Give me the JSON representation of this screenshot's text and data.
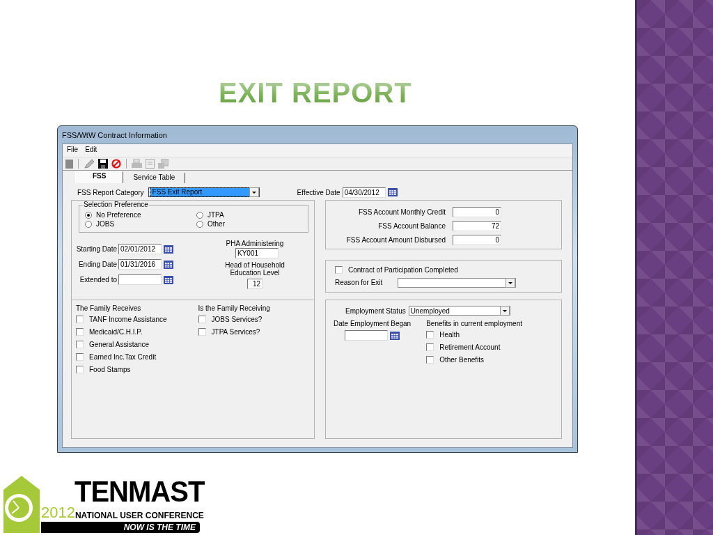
{
  "slide": {
    "title": "EXIT REPORT"
  },
  "window": {
    "title": "FSS/WtW Contract Information"
  },
  "menu": [
    "File",
    "Edit"
  ],
  "tabs": [
    {
      "label": "FSS",
      "selected": true
    },
    {
      "label": "Service Table",
      "selected": false
    }
  ],
  "report_category": {
    "label": "FSS Report Category",
    "value": "FSS Exit Report"
  },
  "effective_date": {
    "label": "Effective Date",
    "value": "04/30/2012"
  },
  "selection_preference": {
    "title": "Selection Preference",
    "options": [
      {
        "label": "No Preference",
        "selected": true
      },
      {
        "label": "JTPA",
        "selected": false
      },
      {
        "label": "JOBS",
        "selected": false
      },
      {
        "label": "Other",
        "selected": false
      }
    ]
  },
  "dates": [
    {
      "label": "Starting Date",
      "value": "02/01/2012"
    },
    {
      "label": "Ending Date",
      "value": "01/31/2016"
    },
    {
      "label": "Extended to"
    }
  ],
  "pha": {
    "label": "PHA Administering",
    "value": "KY001"
  },
  "education": {
    "label": "Head of Household Education Level",
    "value": "12"
  },
  "account": [
    {
      "label": "FSS Account Monthly Credit",
      "value": "0"
    },
    {
      "label": "FSS Account Balance",
      "value": "72"
    },
    {
      "label": "FSS Account Amount Disbursed",
      "value": "0"
    }
  ],
  "contract_completed": {
    "label": "Contract of Participation Completed",
    "checked": false
  },
  "reason_for_exit": {
    "label": "Reason for Exit"
  },
  "family_receives": {
    "title": "The Family Receives",
    "items": [
      {
        "label": "TANF Income Assistance",
        "checked": false
      },
      {
        "label": "Medicaid/C.H.I.P.",
        "checked": false
      },
      {
        "label": "General Assistance",
        "checked": false
      },
      {
        "label": "Earned Inc.Tax Credit",
        "checked": false
      },
      {
        "label": "Food Stamps",
        "checked": false
      }
    ]
  },
  "family_receiving": {
    "title": "Is the Family Receiving",
    "items": [
      {
        "label": "JOBS Services?",
        "checked": false
      },
      {
        "label": "JTPA Services?",
        "checked": false
      }
    ]
  },
  "employment_status": {
    "label": "Employment Status",
    "value": "Unemployed"
  },
  "employment_began": {
    "label": "Date Employment Began"
  },
  "benefits": {
    "title": "Benefits in current employment",
    "items": [
      {
        "label": "Health",
        "checked": false
      },
      {
        "label": "Retirement Account",
        "checked": false
      },
      {
        "label": "Other Benefits",
        "checked": false
      }
    ]
  },
  "logo": {
    "name": "TENMAST",
    "year": "2012",
    "subtitle": "NATIONAL USER CONFERENCE",
    "tagline": "NOW IS THE TIME"
  }
}
